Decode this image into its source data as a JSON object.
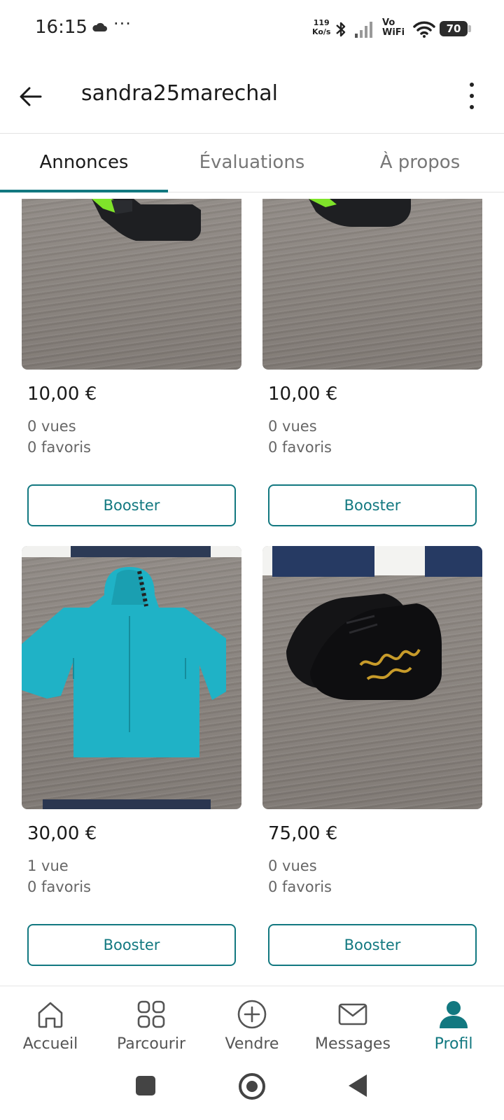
{
  "status_bar": {
    "time": "16:15",
    "dots": "···",
    "net_speed_value": "119",
    "net_speed_unit": "Ko/s",
    "vowifi_top": "Vo",
    "vowifi_bottom": "WiFi",
    "battery": "70",
    "icons": [
      "cloud-icon",
      "bluetooth-icon",
      "signal-icon",
      "wifi-icon",
      "battery-icon"
    ]
  },
  "header": {
    "title": "sandra25marechal",
    "icons": [
      "back-arrow-icon",
      "more-vertical-icon"
    ]
  },
  "tabs": [
    {
      "label": "Annonces",
      "active": true
    },
    {
      "label": "Évaluations",
      "active": false
    },
    {
      "label": "À propos",
      "active": false
    }
  ],
  "listings": [
    {
      "price": "10,00 €",
      "views": "0 vues",
      "favorites": "0 favoris",
      "button": "Booster",
      "image": "sneakers-on-wood-photo"
    },
    {
      "price": "10,00 €",
      "views": "0 vues",
      "favorites": "0 favoris",
      "button": "Booster",
      "image": "sneakers-on-wood-photo"
    },
    {
      "price": "30,00 €",
      "views": "1 vue",
      "favorites": "0 favoris",
      "button": "Booster",
      "image": "turquoise-rain-jacket-photo"
    },
    {
      "price": "75,00 €",
      "views": "0 vues",
      "favorites": "0 favoris",
      "button": "Booster",
      "image": "black-gold-sneakers-photo"
    }
  ],
  "bottom_nav": [
    {
      "label": "Accueil",
      "icon": "home-icon",
      "active": false
    },
    {
      "label": "Parcourir",
      "icon": "grid-icon",
      "active": false
    },
    {
      "label": "Vendre",
      "icon": "plus-circle-icon",
      "active": false
    },
    {
      "label": "Messages",
      "icon": "envelope-icon",
      "active": false
    },
    {
      "label": "Profil",
      "icon": "person-icon",
      "active": true
    }
  ],
  "colors": {
    "accent": "#127880",
    "text": "#1a1a1a",
    "muted": "#666666"
  }
}
